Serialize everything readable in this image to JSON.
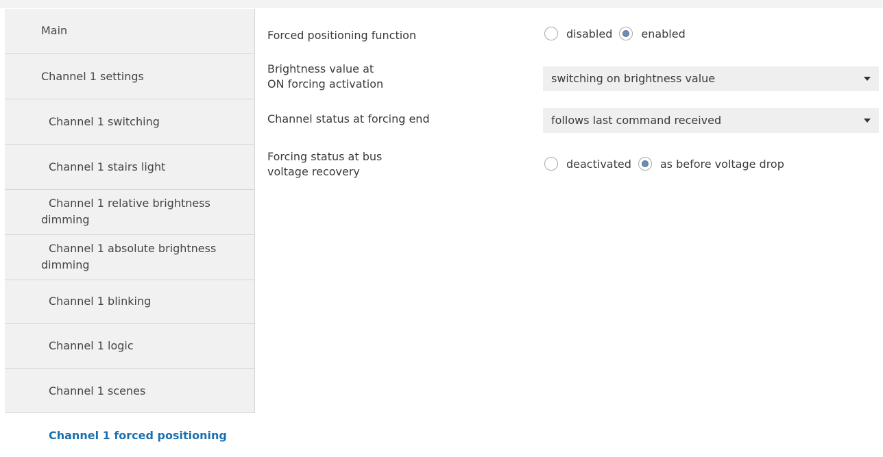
{
  "sidebar": {
    "items": [
      {
        "label": "Main"
      },
      {
        "label": "Channel 1 settings"
      },
      {
        "label": "Channel 1 switching"
      },
      {
        "label": "Channel 1 stairs light"
      },
      {
        "label": "Channel 1 relative brightness dimming"
      },
      {
        "label": "Channel 1 absolute brightness dimming"
      },
      {
        "label": "Channel 1 blinking"
      },
      {
        "label": "Channel 1 logic"
      },
      {
        "label": "Channel 1 scenes"
      },
      {
        "label": "Channel 1 forced positioning"
      }
    ],
    "active_index": 9
  },
  "params": {
    "forced_positioning": {
      "label": "Forced positioning function",
      "options": [
        "disabled",
        "enabled"
      ],
      "selected": "enabled"
    },
    "brightness_on": {
      "label_line1": "Brightness value at",
      "label_line2": "ON forcing activation",
      "value": "switching on brightness value"
    },
    "status_end": {
      "label": "Channel status at forcing end",
      "value": "follows last command received"
    },
    "bus_recovery": {
      "label_line1": "Forcing status at bus",
      "label_line2": "voltage recovery",
      "options": [
        "deactivated",
        "as before voltage drop"
      ],
      "selected": "as before voltage drop"
    }
  },
  "colors": {
    "active_nav": "#1a6fb0",
    "nav_bg": "#f1f1f1",
    "radio_fill": "#6d8fb3"
  }
}
